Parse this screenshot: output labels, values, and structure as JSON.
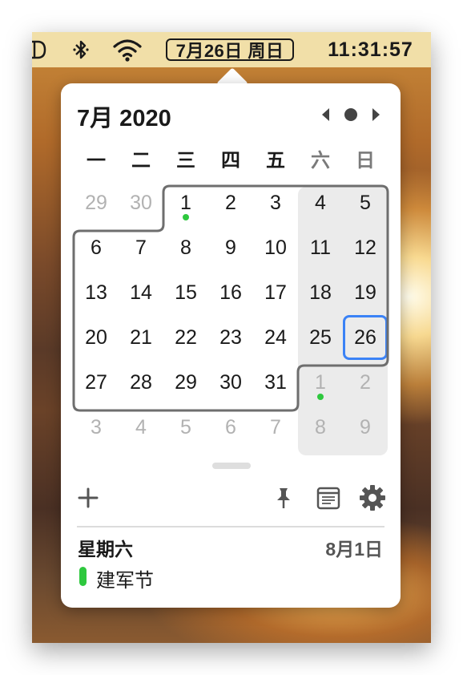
{
  "menubar": {
    "date_label": "7月26日 周日",
    "time": "11:31:57",
    "icons": [
      "app-icon-partial",
      "bluetooth-icon",
      "wifi-icon"
    ]
  },
  "calendar": {
    "title": "7月 2020",
    "nav": {
      "prev": "chevron-left-icon",
      "today": "today-dot-icon",
      "next": "chevron-right-icon"
    },
    "weekdays": [
      "一",
      "二",
      "三",
      "四",
      "五",
      "六",
      "日"
    ],
    "weeks": [
      [
        "29",
        "30",
        "1",
        "2",
        "3",
        "4",
        "5"
      ],
      [
        "6",
        "7",
        "8",
        "9",
        "10",
        "11",
        "12"
      ],
      [
        "13",
        "14",
        "15",
        "16",
        "17",
        "18",
        "19"
      ],
      [
        "20",
        "21",
        "22",
        "23",
        "24",
        "25",
        "26"
      ],
      [
        "27",
        "28",
        "29",
        "30",
        "31",
        "1",
        "2"
      ],
      [
        "3",
        "4",
        "5",
        "6",
        "7",
        "8",
        "9"
      ]
    ],
    "today": "26",
    "event_dots": [
      "7月1日",
      "8月1日"
    ]
  },
  "toolbar": {
    "icons": [
      "add-icon",
      "pin-icon",
      "notes-icon",
      "gear-icon"
    ]
  },
  "event_panel": {
    "day_name": "星期六",
    "date": "8月1日",
    "events": [
      {
        "title": "建军节",
        "color": "#2ec83e"
      }
    ]
  },
  "colors": {
    "accent": "#3b82f6",
    "event_green": "#2ec83e",
    "menubar": "#f1dfa8"
  }
}
